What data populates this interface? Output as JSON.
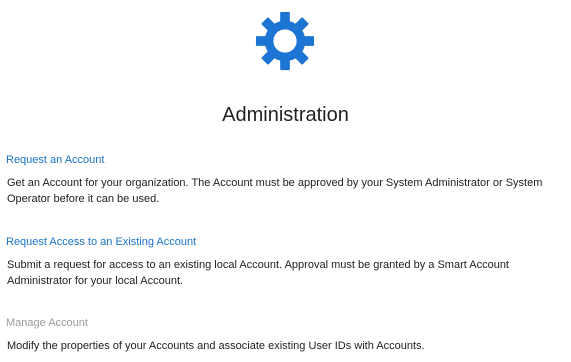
{
  "page": {
    "icon": "gear-icon",
    "icon_color": "#1c75d2",
    "title": "Administration"
  },
  "sections": [
    {
      "link": "Request an Account",
      "enabled": true,
      "description": "Get an Account for your organization. The Account must be approved by your System Administrator or System Operator before it can be used."
    },
    {
      "link": "Request Access to an Existing Account",
      "enabled": true,
      "description": "Submit a request for access to an existing local Account. Approval must be granted by a Smart Account Administrator for your local Account."
    },
    {
      "link": "Manage Account",
      "enabled": false,
      "description": "Modify the properties of your Accounts and associate existing User IDs with Accounts."
    }
  ],
  "colors": {
    "link": "#1a73c9",
    "disabled_link": "#9a9a9a",
    "text": "#222222"
  }
}
